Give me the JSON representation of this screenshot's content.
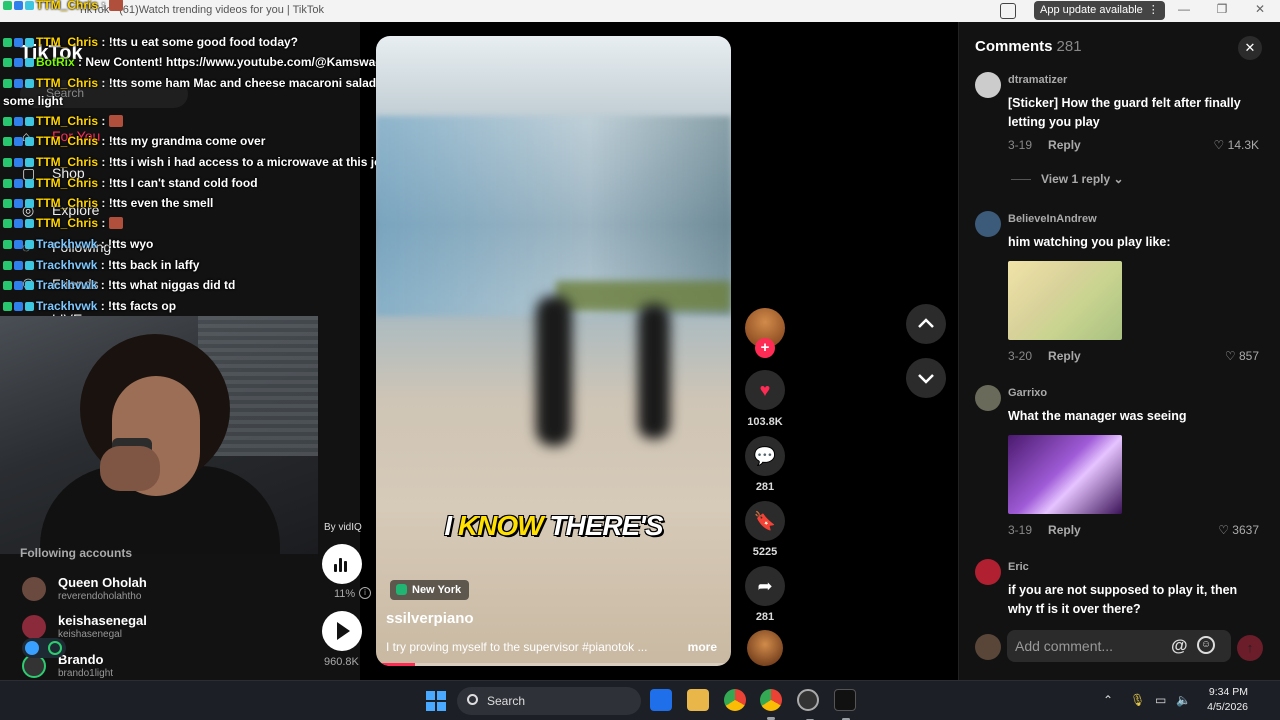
{
  "window": {
    "title": "TikTok - (61)Watch trending videos for you | TikTok",
    "update_button": "App update available"
  },
  "sidebar": {
    "logo": "TikTok",
    "search_placeholder": "Search",
    "items": [
      {
        "label": "For You",
        "icon": "home-icon"
      },
      {
        "label": "Shop",
        "icon": "shop-icon"
      },
      {
        "label": "Explore",
        "icon": "compass-icon"
      },
      {
        "label": "Following",
        "icon": "following-icon"
      },
      {
        "label": "Friends",
        "icon": "friends-icon"
      },
      {
        "label": "LIVE",
        "icon": "live-icon"
      }
    ],
    "following_header": "Following accounts",
    "accounts": [
      {
        "name": "Queen Oholah",
        "handle": "reverendoholahtho"
      },
      {
        "name": "keishasenegal",
        "handle": "keishasenegal"
      },
      {
        "name": "Brando",
        "handle": "brando1light"
      }
    ]
  },
  "chat": {
    "lines": [
      {
        "user": "TTM_Chris",
        "msg": "",
        "emote": true,
        "kind": "ttm"
      },
      {
        "user": "TTM_Chris",
        "msg": "!tts u eat some good food today?",
        "emote": false,
        "kind": "ttm"
      },
      {
        "user": "BotRix",
        "msg": "New Content! https://www.youtube.com/@Kamswaelive",
        "emote": false,
        "kind": "botrix"
      },
      {
        "user": "TTM_Chris",
        "msg": "!tts some ham Mac and cheese macaroni salad and rice",
        "emote": false,
        "kind": "ttm"
      },
      {
        "user": "",
        "msg": "some light",
        "emote": false,
        "kind": "cont"
      },
      {
        "user": "TTM_Chris",
        "msg": "",
        "emote": true,
        "kind": "ttm"
      },
      {
        "user": "TTM_Chris",
        "msg": "!tts my grandma come over",
        "emote": false,
        "kind": "ttm"
      },
      {
        "user": "TTM_Chris",
        "msg": "!tts i wish i had access to a microwave at this job",
        "emote": false,
        "kind": "ttm"
      },
      {
        "user": "TTM_Chris",
        "msg": "!tts I can't stand cold food",
        "emote": false,
        "kind": "ttm"
      },
      {
        "user": "TTM_Chris",
        "msg": "!tts even the smell",
        "emote": false,
        "kind": "ttm"
      },
      {
        "user": "TTM_Chris",
        "msg": "",
        "emote": true,
        "kind": "ttm"
      },
      {
        "user": "Trackhvwk",
        "msg": "!tts wyo",
        "emote": false,
        "kind": "track"
      },
      {
        "user": "Trackhvwk",
        "msg": "!tts back in laffy",
        "emote": false,
        "kind": "track"
      },
      {
        "user": "Trackhvwk",
        "msg": "!tts what niggas did td",
        "emote": false,
        "kind": "track"
      },
      {
        "user": "Trackhvwk",
        "msg": "!tts facts op",
        "emote": false,
        "kind": "track"
      }
    ]
  },
  "overlay": {
    "by_label": "By vidIQ",
    "percent": "11%",
    "views": "960.8K"
  },
  "video": {
    "caption_white_1": "I ",
    "caption_yellow": "KNOW",
    "caption_white_2": " THERE'S",
    "location": "New York",
    "author": "ssilverpiano",
    "description": "I try proving myself to the supervisor #pianotok ...",
    "more": "more",
    "progress_fraction": 0.11
  },
  "actions": {
    "likes": "103.8K",
    "comments": "281",
    "saves": "5225",
    "shares": "281"
  },
  "comments": {
    "title": "Comments",
    "count": "281",
    "input_placeholder": "Add comment...",
    "items": [
      {
        "user": "dtramatizer",
        "text": "[Sticker] How the guard felt after finally letting you play",
        "date": "3-19",
        "reply": "Reply",
        "likes": "14.3K",
        "image": ""
      },
      {
        "user": "BelieveInAndrew",
        "text": "him watching you play like:",
        "date": "3-20",
        "reply": "Reply",
        "likes": "857",
        "image": "rick"
      },
      {
        "user": "Garrixo",
        "text": "What the manager was seeing",
        "date": "3-19",
        "reply": "Reply",
        "likes": "3637",
        "image": "alien"
      },
      {
        "user": "Eric",
        "text": "if you are not supposed to play it, then why tf is it over there?",
        "date": "",
        "reply": "",
        "likes": "",
        "image": ""
      }
    ],
    "view_replies": "View 1 reply"
  },
  "taskbar": {
    "search": "Search",
    "time": "9:34 PM",
    "date": "4/5/2026"
  }
}
